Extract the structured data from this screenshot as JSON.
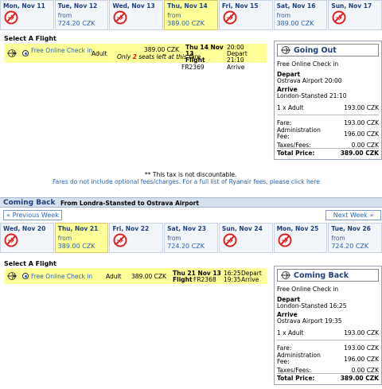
{
  "outbound": {
    "dates": [
      {
        "label": "Mon, Nov 11",
        "available": false
      },
      {
        "label": "Tue, Nov 12",
        "available": true,
        "from": "from",
        "price": "724.20 CZK"
      },
      {
        "label": "Wed, Nov 13",
        "available": false
      },
      {
        "label": "Thu, Nov 14",
        "available": true,
        "selected": true,
        "from": "from",
        "price": "389.00 CZK"
      },
      {
        "label": "Fri, Nov 15",
        "available": false
      },
      {
        "label": "Sat, Nov 16",
        "available": true,
        "from": "from",
        "price": "389.00 CZK"
      },
      {
        "label": "Sun, Nov 17",
        "available": false
      }
    ],
    "select_heading": "Select A Flight",
    "flight": {
      "option": "Free Online Check in",
      "passenger": "Adult",
      "price": "389.00 CZK",
      "seats_prefix": "Only",
      "seats_count": "2",
      "seats_suffix": "seats left at this fare",
      "date": "Thu 14 Nov 13",
      "flight_label": "Flight",
      "flight_no": "FR2369",
      "dep_time": "20:00",
      "dep_label": "Depart",
      "arr_time": "21:10",
      "arr_label": "Arrive"
    },
    "panel": {
      "title": "Going Out",
      "option": "Free Online Check in",
      "depart_label": "Depart",
      "depart_value": "Ostrava Airport 20:00",
      "arrive_label": "Arrive",
      "arrive_value": "London-Stansted 21:10",
      "pax": "1 x Adult",
      "pax_price": "193.00 CZK",
      "fare_label": "Fare:",
      "fare_value": "193.00 CZK",
      "admin_label": "Administration Fee:",
      "admin_value": "196.00 CZK",
      "taxes_label": "Taxes/Fees:",
      "taxes_value": "0.00 CZK",
      "total_label": "Total Price:",
      "total_value": "389.00 CZK"
    },
    "tax_note": "** This tax is not discountable.",
    "fees_note": "Fares do not include optional fees/charges. For a full list of Ryanair fees, please click here"
  },
  "inbound": {
    "heading": "Coming Back",
    "route": "From Londra-Stansted to Ostrava Airport",
    "prev_week": "« Previous Week",
    "next_week": "Next Week »",
    "dates": [
      {
        "label": "Wed, Nov 20",
        "available": false
      },
      {
        "label": "Thu, Nov 21",
        "available": true,
        "selected": true,
        "from": "from",
        "price": "389.00 CZK"
      },
      {
        "label": "Fri, Nov 22",
        "available": false
      },
      {
        "label": "Sat, Nov 23",
        "available": true,
        "from": "from",
        "price": "724.20 CZK"
      },
      {
        "label": "Sun, Nov 24",
        "available": false
      },
      {
        "label": "Mon, Nov 25",
        "available": false
      },
      {
        "label": "Tue, Nov 26",
        "available": true,
        "from": "from",
        "price": "724.20 CZK"
      }
    ],
    "select_heading": "Select A Flight",
    "flight": {
      "option": "Free Online Check in",
      "passenger": "Adult",
      "price": "389.00 CZK",
      "date": "Thu 21 Nov 13",
      "flight_label": "Flight",
      "flight_no": "FR2368",
      "dep_time": "16:25",
      "dep_label": "Depart",
      "arr_time": "19:35",
      "arr_label": "Arrive"
    },
    "panel": {
      "title": "Coming Back",
      "option": "Free Online Check in",
      "depart_label": "Depart",
      "depart_value": "London-Stansted 16:25",
      "arrive_label": "Arrive",
      "arrive_value": "Ostrava Airport 19:35",
      "pax": "1 x Adult",
      "pax_price": "193.00 CZK",
      "fare_label": "Fare:",
      "fare_value": "193.00 CZK",
      "admin_label": "Administration Fee:",
      "admin_value": "196.00 CZK",
      "taxes_label": "Taxes/Fees:",
      "taxes_value": "0.00 CZK",
      "total_label": "Total Price:",
      "total_value": "389.00 CZK"
    }
  }
}
